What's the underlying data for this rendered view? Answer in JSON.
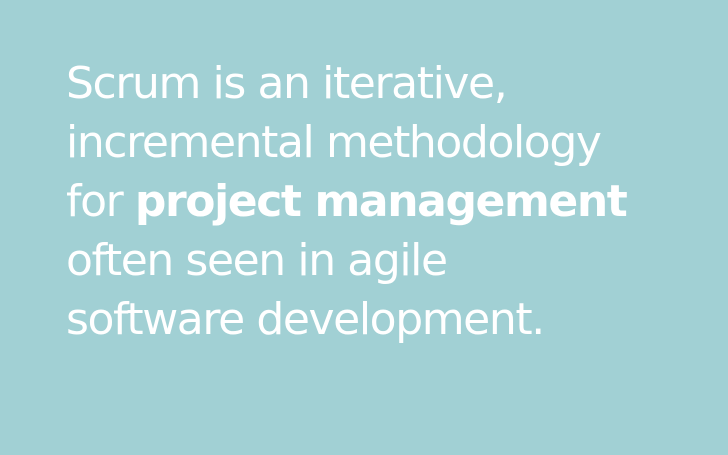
{
  "quote": {
    "line1": "Scrum is an iterative,",
    "line2": "incremental methodology",
    "line3_prefix": "for",
    "line3_emphasis": "project management",
    "line4": "often seen in agile",
    "line5": "software development."
  },
  "colors": {
    "background": "#a1d0d4",
    "text": "#ffffff"
  }
}
